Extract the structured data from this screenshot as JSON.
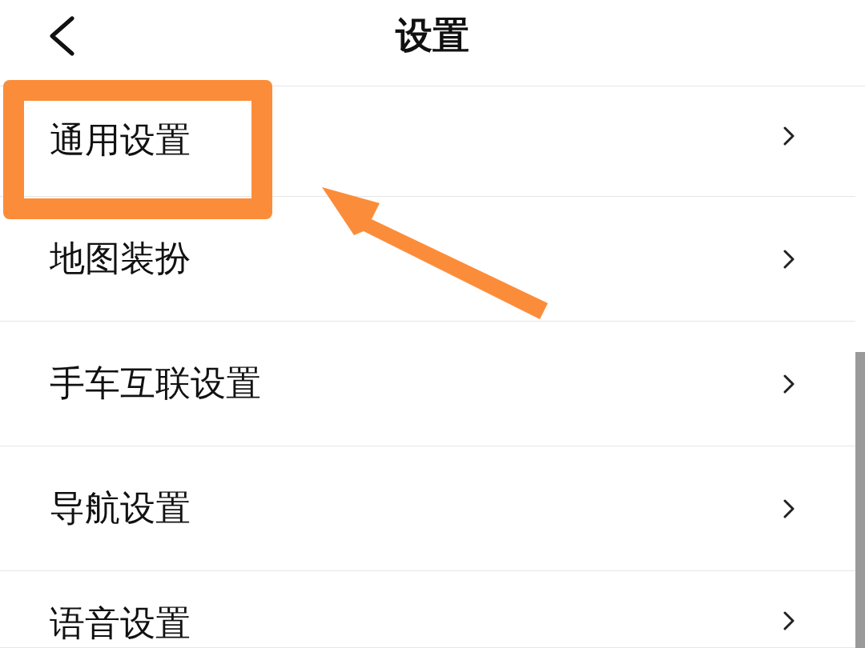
{
  "header": {
    "title": "设置"
  },
  "items": [
    {
      "label": "通用设置",
      "highlighted": true
    },
    {
      "label": "地图装扮",
      "highlighted": false
    },
    {
      "label": "手车互联设置",
      "highlighted": false
    },
    {
      "label": "导航设置",
      "highlighted": false
    },
    {
      "label": "语音设置",
      "highlighted": false
    }
  ]
}
